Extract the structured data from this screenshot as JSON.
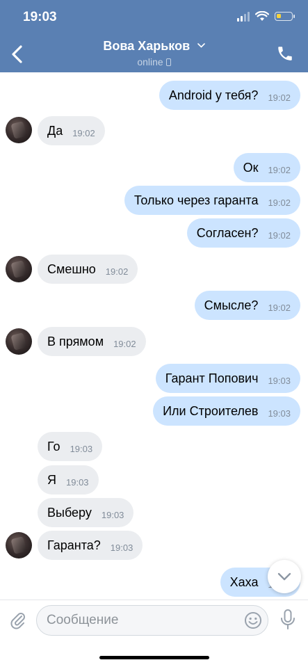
{
  "status_bar": {
    "time": "19:03"
  },
  "header": {
    "title": "Вова Харьков",
    "subtitle": "online"
  },
  "messages": [
    {
      "dir": "out",
      "text": "Android у тебя?",
      "time": "19:02"
    },
    {
      "dir": "in",
      "text": "Да",
      "time": "19:02"
    },
    {
      "dir": "out",
      "text": "Ок",
      "time": "19:02"
    },
    {
      "dir": "out",
      "text": "Только через гаранта",
      "time": "19:02"
    },
    {
      "dir": "out",
      "text": "Согласен?",
      "time": "19:02"
    },
    {
      "dir": "in",
      "text": "Смешно",
      "time": "19:02"
    },
    {
      "dir": "out",
      "text": "Смысле?",
      "time": "19:02"
    },
    {
      "dir": "in",
      "text": "В прямом",
      "time": "19:02"
    },
    {
      "dir": "out",
      "text": "Гарант Попович",
      "time": "19:03"
    },
    {
      "dir": "out",
      "text": "Или Строителев",
      "time": "19:03"
    },
    {
      "dir": "in",
      "text": "Го",
      "time": "19:03"
    },
    {
      "dir": "in",
      "text": "Я",
      "time": "19:03"
    },
    {
      "dir": "in",
      "text": "Выберу",
      "time": "19:03"
    },
    {
      "dir": "in",
      "text": "Гаранта?",
      "time": "19:03"
    },
    {
      "dir": "out",
      "text": "Хаха",
      "time": "19:03"
    }
  ],
  "composer": {
    "placeholder": "Сообщение"
  },
  "colors": {
    "header_bg": "#5a80b3",
    "out_bubble": "#cce4ff",
    "in_bubble": "#ebedf0",
    "time_text": "#818c99",
    "battery": "#f6d33d"
  },
  "icons": [
    "back-arrow-icon",
    "chevron-down-icon",
    "phone-icon",
    "attach-icon",
    "emoji-icon",
    "microphone-icon",
    "chevron-down-icon"
  ],
  "battery_level": 0.3
}
